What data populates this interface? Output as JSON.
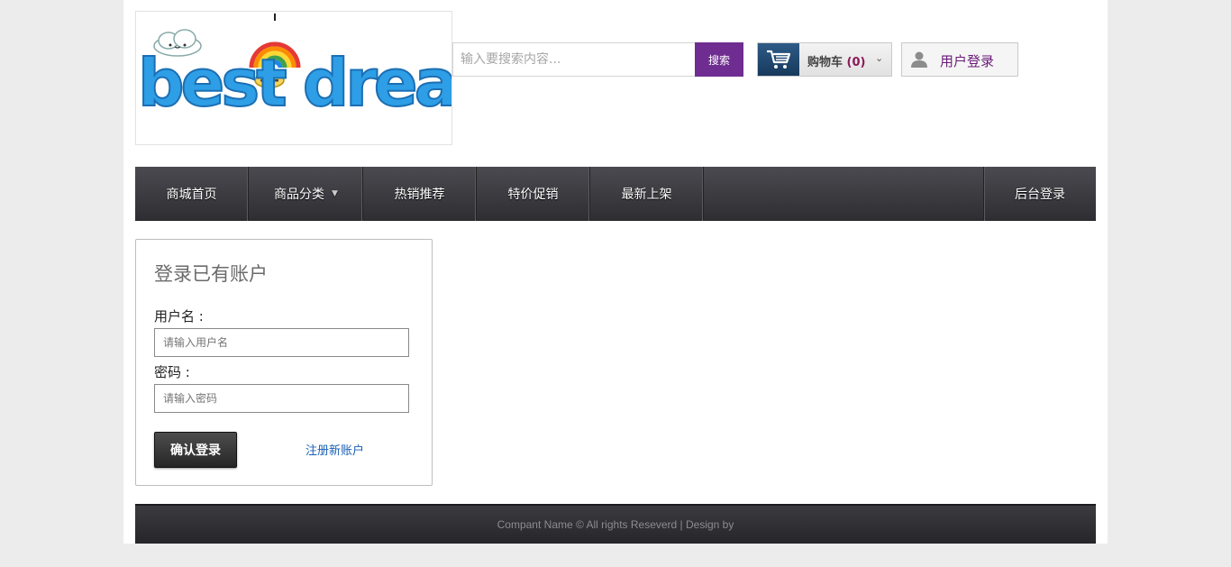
{
  "logo": {
    "text": "best dream"
  },
  "search": {
    "placeholder": "输入要搜索内容...",
    "button_label": "搜索"
  },
  "cart": {
    "label": "购物车",
    "count": "0",
    "icon": "cart-icon"
  },
  "user": {
    "login_label": "用户登录",
    "icon": "user-icon"
  },
  "nav": {
    "items": [
      {
        "label": "商城首页"
      },
      {
        "label": "商品分类",
        "has_dropdown": true
      },
      {
        "label": "热销推荐"
      },
      {
        "label": "特价促销"
      },
      {
        "label": "最新上架"
      }
    ],
    "admin_label": "后台登录"
  },
  "login_panel": {
    "title": "登录已有账户",
    "username_label": "用户名 :",
    "username_placeholder": "请输入用户名",
    "password_label": "密码 :",
    "password_placeholder": "请输入密码",
    "submit_label": "确认登录",
    "register_label": "注册新账户"
  },
  "footer": {
    "text": "Compant Name © All rights Reseverd | Design by"
  },
  "colors": {
    "accent_purple": "#6f2d91",
    "nav_dark": "#3a3a3f",
    "cart_blue": "#1f4a72",
    "link_blue": "#1a5fb4"
  }
}
